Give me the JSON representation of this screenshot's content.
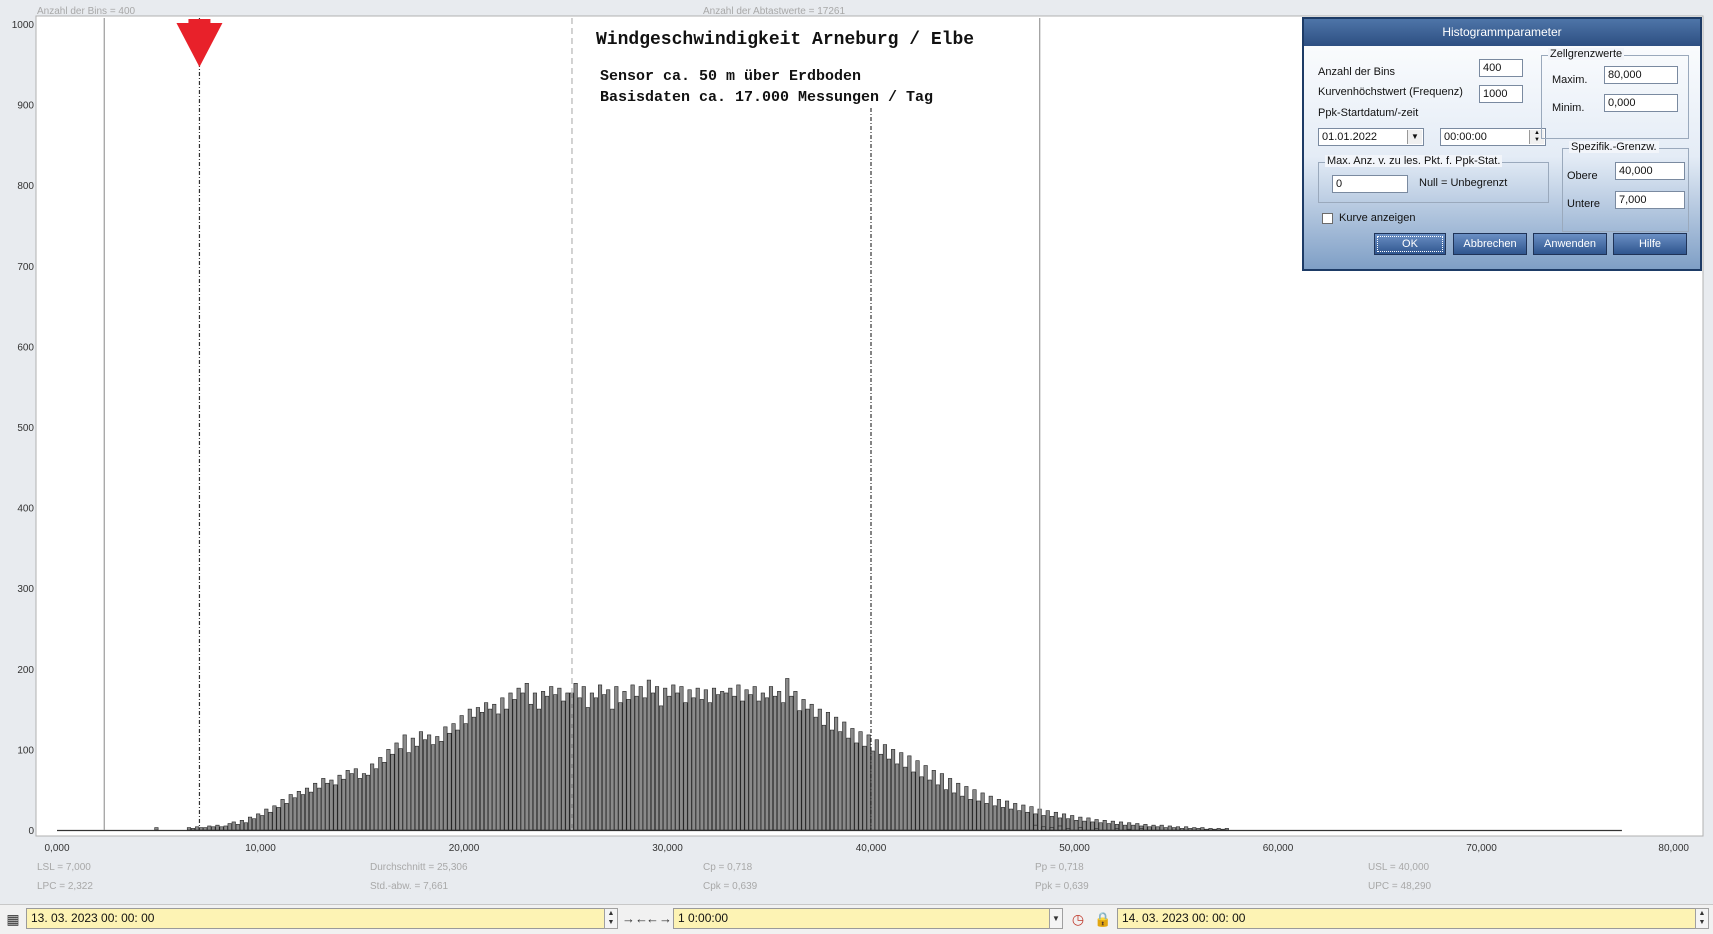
{
  "header": {
    "bins_label": "Anzahl der Bins =  400",
    "samples_label": "Anzahl der Abtastwerte = 17261"
  },
  "chart_title": {
    "line1": "Windgeschwindigkeit  Arneburg / Elbe",
    "line2": "Sensor ca. 50 m über Erdboden",
    "line3": "Basisdaten ca. 17.000 Messungen / Tag"
  },
  "stats": {
    "lsl": "LSL = 7,000",
    "lpc": "LPC = 2,322",
    "mean": "Durchschnitt = 25,306",
    "std": "Std.-abw. = 7,661",
    "cp": "Cp = 0,718",
    "cpk": "Cpk = 0,639",
    "pp": "Pp = 0,718",
    "ppk": "Ppk = 0,639",
    "usl": "USL = 40,000",
    "upc": "UPC = 48,290"
  },
  "chart_data": {
    "type": "bar",
    "xlim": [
      0,
      80
    ],
    "ylim": [
      0,
      1000
    ],
    "x_ticks": [
      0,
      10,
      20,
      30,
      40,
      50,
      60,
      70,
      80
    ],
    "x_tick_labels": [
      "0,000",
      "10,000",
      "20,000",
      "30,000",
      "40,000",
      "50,000",
      "60,000",
      "70,000",
      "80,000"
    ],
    "y_ticks": [
      0,
      100,
      200,
      300,
      400,
      500,
      600,
      700,
      800,
      900,
      1000
    ],
    "y_tick_labels": [
      "0",
      "100",
      "200",
      "300",
      "400",
      "500",
      "600",
      "700",
      "800",
      "900",
      "1000"
    ],
    "bin_width": 0.2,
    "bins_start": 6.4,
    "values": [
      3,
      2,
      4,
      3,
      3,
      5,
      4,
      6,
      4,
      5,
      8,
      10,
      7,
      12,
      9,
      16,
      14,
      20,
      18,
      26,
      22,
      30,
      28,
      38,
      33,
      44,
      40,
      48,
      44,
      52,
      47,
      58,
      52,
      64,
      58,
      62,
      56,
      68,
      63,
      74,
      70,
      76,
      64,
      70,
      68,
      82,
      76,
      90,
      84,
      100,
      94,
      108,
      101,
      118,
      96,
      114,
      104,
      122,
      112,
      118,
      106,
      116,
      110,
      128,
      120,
      132,
      124,
      142,
      132,
      150,
      140,
      152,
      146,
      158,
      150,
      156,
      144,
      164,
      150,
      170,
      162,
      176,
      170,
      182,
      156,
      170,
      150,
      172,
      166,
      178,
      168,
      176,
      160,
      170,
      170,
      182,
      164,
      178,
      152,
      170,
      164,
      180,
      168,
      174,
      150,
      178,
      158,
      172,
      162,
      180,
      166,
      178,
      164,
      186,
      170,
      178,
      154,
      176,
      166,
      180,
      170,
      178,
      158,
      174,
      164,
      176,
      162,
      174,
      158,
      176,
      168,
      172,
      170,
      176,
      166,
      180,
      160,
      174,
      168,
      178,
      160,
      170,
      164,
      178,
      166,
      172,
      158,
      188,
      166,
      172,
      148,
      162,
      150,
      156,
      140,
      150,
      130,
      146,
      124,
      140,
      122,
      134,
      114,
      126,
      108,
      122,
      104,
      118,
      98,
      112,
      94,
      106,
      88,
      100,
      82,
      96,
      78,
      92,
      72,
      86,
      66,
      80,
      62,
      74,
      56,
      70,
      50,
      64,
      46,
      58,
      42,
      54,
      38,
      50,
      36,
      46,
      33,
      42,
      30,
      38,
      28,
      36,
      26,
      33,
      24,
      31,
      22,
      29,
      20,
      26,
      18,
      24,
      17,
      22,
      15,
      20,
      14,
      18,
      12,
      16,
      11,
      15,
      10,
      13,
      9,
      12,
      8,
      11,
      7,
      10,
      6,
      9,
      6,
      8,
      5,
      7,
      4,
      6,
      4,
      6,
      3,
      5,
      3,
      4,
      2,
      4,
      2,
      3,
      2,
      3,
      1,
      2,
      1,
      2,
      1,
      2
    ],
    "outliers": [
      {
        "x": 4.8,
        "y": 3
      },
      {
        "x": 48.0,
        "y": 6
      },
      {
        "x": 48.4,
        "y": 4
      },
      {
        "x": 48.8,
        "y": 3
      },
      {
        "x": 49.2,
        "y": 5
      },
      {
        "x": 49.6,
        "y": 2
      },
      {
        "x": 50.2,
        "y": 3
      },
      {
        "x": 51.0,
        "y": 2
      },
      {
        "x": 52.0,
        "y": 2
      },
      {
        "x": 52.6,
        "y": 1
      },
      {
        "x": 53.2,
        "y": 2
      }
    ],
    "lines": {
      "lpc": 2.322,
      "lsl": 7.0,
      "mean": 25.306,
      "usl": 40.0,
      "upc": 48.29
    },
    "marker_x": 7.0,
    "bar_color": "#8a8a8a",
    "marker_color": "#e8212a"
  },
  "dialog": {
    "title": "Histogrammparameter",
    "bins_label": "Anzahl der Bins",
    "bins_value": "400",
    "freq_label": "Kurvenhöchstwert (Frequenz)",
    "freq_value": "1000",
    "ppk_label": "Ppk-Startdatum/-zeit",
    "date_value": "01.01.2022",
    "time_value": "00:00:00",
    "cell_group": "Zellgrenzwerte",
    "max_label": "Maxim.",
    "max_value": "80,000",
    "min_label": "Minim.",
    "min_value": "0,000",
    "maxanz_group": "Max. Anz. v. zu les. Pkt. f. Ppk-Stat.",
    "maxanz_value": "0",
    "null_hint": "Null = Unbegrenzt",
    "spec_group": "Spezifik.-Grenzw.",
    "upper_label": "Obere",
    "upper_value": "40,000",
    "lower_label": "Untere",
    "lower_value": "7,000",
    "curve_label": "Kurve anzeigen",
    "ok": "OK",
    "cancel": "Abbrechen",
    "apply": "Anwenden",
    "help": "Hilfe"
  },
  "toolbar": {
    "start": "13. 03. 2023   00: 00: 00",
    "span": "1 0:00:00",
    "end": "14. 03. 2023   00: 00: 00"
  }
}
